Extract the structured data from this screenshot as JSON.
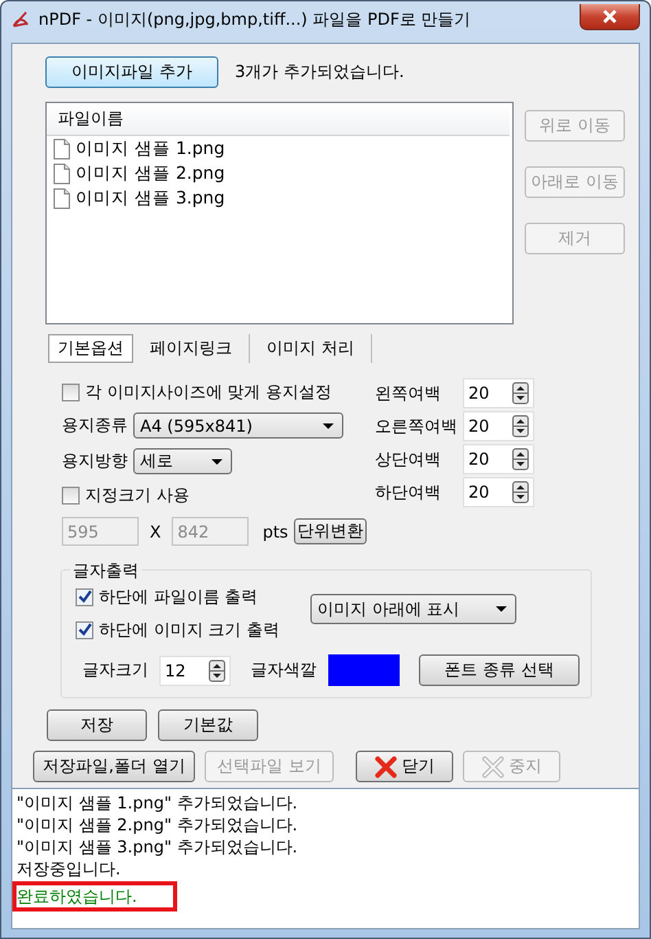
{
  "window": {
    "title": "nPDF - 이미지(png,jpg,bmp,tiff...) 파일을 PDF로 만들기"
  },
  "add_button": "이미지파일 추가",
  "add_status": "3개가 추가되었습니다.",
  "file_list": {
    "header": "파일이름",
    "items": [
      "이미지 샘플 1.png",
      "이미지 샘플 2.png",
      "이미지 샘플 3.png"
    ]
  },
  "side_buttons": [
    {
      "label": "위로 이동",
      "disabled": true
    },
    {
      "label": "아래로 이동",
      "disabled": true
    },
    {
      "label": "제거",
      "disabled": true
    }
  ],
  "tabs": [
    {
      "label": "기본옵션",
      "selected": true
    },
    {
      "label": "페이지링크",
      "selected": false
    },
    {
      "label": "이미지 처리",
      "selected": false
    }
  ],
  "options": {
    "fit_checkbox": {
      "label": "각 이미지사이즈에 맞게 용지설정",
      "checked": false
    },
    "paper_type": {
      "label": "용지종류",
      "value": "A4 (595x841)"
    },
    "orientation": {
      "label": "용지방향",
      "value": "세로"
    },
    "custom_size": {
      "label": "지정크기 사용",
      "checked": false
    },
    "width": {
      "value": "595",
      "disabled": true
    },
    "separator": "X",
    "height": {
      "value": "842",
      "disabled": true
    },
    "unit": "pts",
    "convert_button": "단위변환",
    "margins": [
      {
        "label": "왼쪽여백",
        "value": "20"
      },
      {
        "label": "오른쪽여백",
        "value": "20"
      },
      {
        "label": "상단여백",
        "value": "20"
      },
      {
        "label": "하단여백",
        "value": "20"
      }
    ]
  },
  "text_output": {
    "title": "글자출력",
    "checkboxes": [
      {
        "label": "하단에 파일이름 출력",
        "checked": true
      },
      {
        "label": "하단에 이미지 크기 출력",
        "checked": true
      }
    ],
    "position": "이미지 아래에 표시",
    "font_size": {
      "label": "글자크기",
      "value": "12"
    },
    "font_color": {
      "label": "글자색깔",
      "color": "#0000ff"
    },
    "font_button": "폰트 종류 선택"
  },
  "buttons": [
    "저장",
    "기본값"
  ],
  "actions": [
    {
      "label": "저장파일,폴더 열기",
      "disabled": false,
      "kind": "plain"
    },
    {
      "label": "선택파일 보기",
      "disabled": true,
      "kind": "plain"
    },
    {
      "label": "닫기",
      "disabled": false,
      "kind": "close"
    },
    {
      "label": "중지",
      "disabled": true,
      "kind": "stop"
    }
  ],
  "log": [
    {
      "text": "\"이미지 샘플 1.png\" 추가되었습니다.",
      "color": "#000000",
      "highlighted": false
    },
    {
      "text": "\"이미지 샘플 2.png\" 추가되었습니다.",
      "color": "#000000",
      "highlighted": false
    },
    {
      "text": "\"이미지 샘플 3.png\" 추가되었습니다.",
      "color": "#000000",
      "highlighted": false
    },
    {
      "text": "저장중입니다.",
      "color": "#000000",
      "highlighted": false
    },
    {
      "text": "완료하였습니다.",
      "color": "#008000",
      "highlighted": true
    }
  ]
}
